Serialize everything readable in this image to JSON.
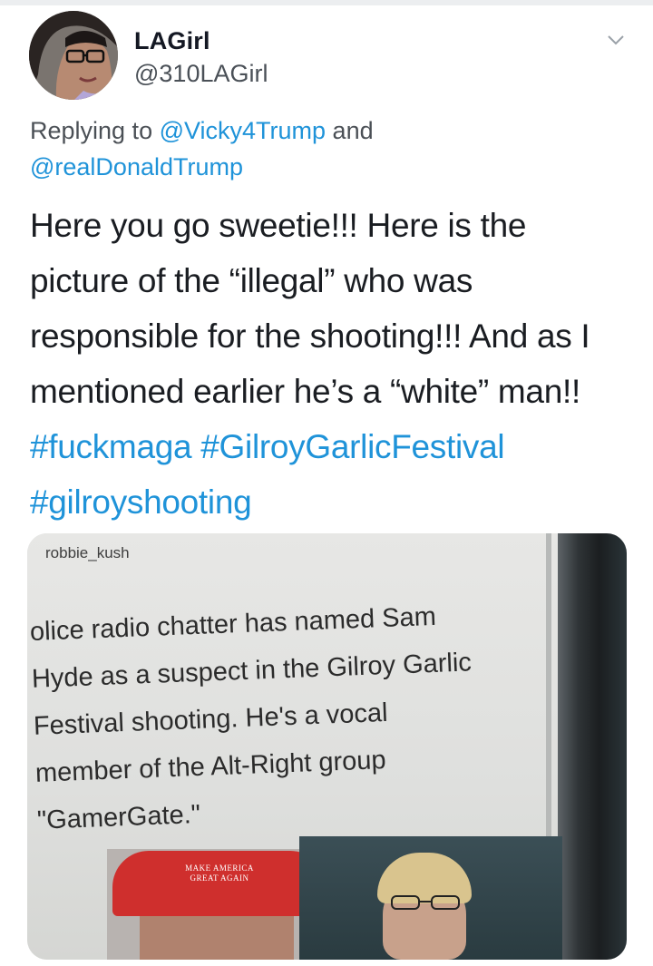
{
  "tweet": {
    "display_name": "LAGirl",
    "handle": "@310LAGirl",
    "reply_prefix": "Replying to ",
    "reply_mention_1": "@Vicky4Trump",
    "reply_join": " and",
    "reply_mention_2": "@realDonaldTrump",
    "text_lines": [
      "Here you go sweetie!!! Here is the",
      "picture of the “illegal” who was",
      "responsible for the shooting!!! And as I",
      "mentioned earlier he’s a “white” man!!"
    ],
    "hashtags": [
      "#fuckmaga",
      "#GilroyGarlicFestival",
      "#gilroyshooting"
    ]
  },
  "media": {
    "source_username": "robbie_kush",
    "caption_lines": [
      "olice radio chatter has named Sam",
      "Hyde as a suspect in the Gilroy Garlic",
      "Festival shooting. He's a vocal",
      "member of the Alt-Right group",
      "\"GamerGate.\""
    ],
    "cap_text_line1": "MAKE AMERICA",
    "cap_text_line2": "GREAT AGAIN"
  },
  "icons": {
    "menu": "chevron-down-icon",
    "avatar": "avatar-photo"
  },
  "colors": {
    "link": "#1f93d9",
    "text": "#1a1d22",
    "secondary": "#4a5057"
  }
}
